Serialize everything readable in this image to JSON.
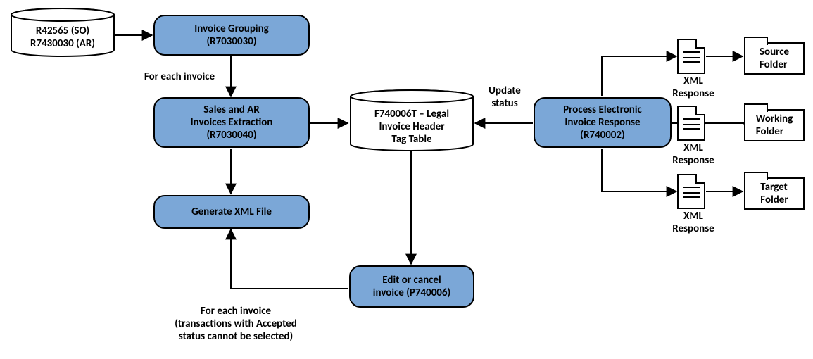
{
  "nodes": {
    "start_db": {
      "line1": "R42565 (SO)",
      "line2": "R7430030  (AR)"
    },
    "invoice_grouping": {
      "line1": "Invoice Grouping",
      "line2": "(R7030030)"
    },
    "sales_ar_extraction": {
      "line1": "Sales and AR",
      "line2": "Invoices Extraction",
      "line3": "(R7030040)"
    },
    "generate_xml": {
      "line1": "Generate XML File"
    },
    "edit_cancel": {
      "line1": "Edit or cancel",
      "line2": "invoice (P740006)"
    },
    "tag_table_db": {
      "line1": "F740006T – Legal",
      "line2": "Invoice Header",
      "line3": "Tag Table"
    },
    "process_response": {
      "line1": "Process Electronic",
      "line2": "Invoice Response",
      "line3": "(R740002)"
    },
    "source_folder": {
      "line1": "Source",
      "line2": "Folder"
    },
    "working_folder": {
      "line1": "Working",
      "line2": "Folder"
    },
    "target_folder": {
      "line1": "Target",
      "line2": "Folder"
    }
  },
  "labels": {
    "for_each_invoice": "For each invoice",
    "update_status": {
      "line1": "Update",
      "line2": "status"
    },
    "xml_resp1": {
      "line1": "XML",
      "line2": "Response"
    },
    "xml_resp2": {
      "line1": "XML",
      "line2": "Response"
    },
    "xml_resp3": {
      "line1": "XML",
      "line2": "Response"
    },
    "for_each_accepted": {
      "line1": "For each invoice",
      "line2": "(transactions with Accepted",
      "line3": "status cannot be selected)"
    }
  }
}
